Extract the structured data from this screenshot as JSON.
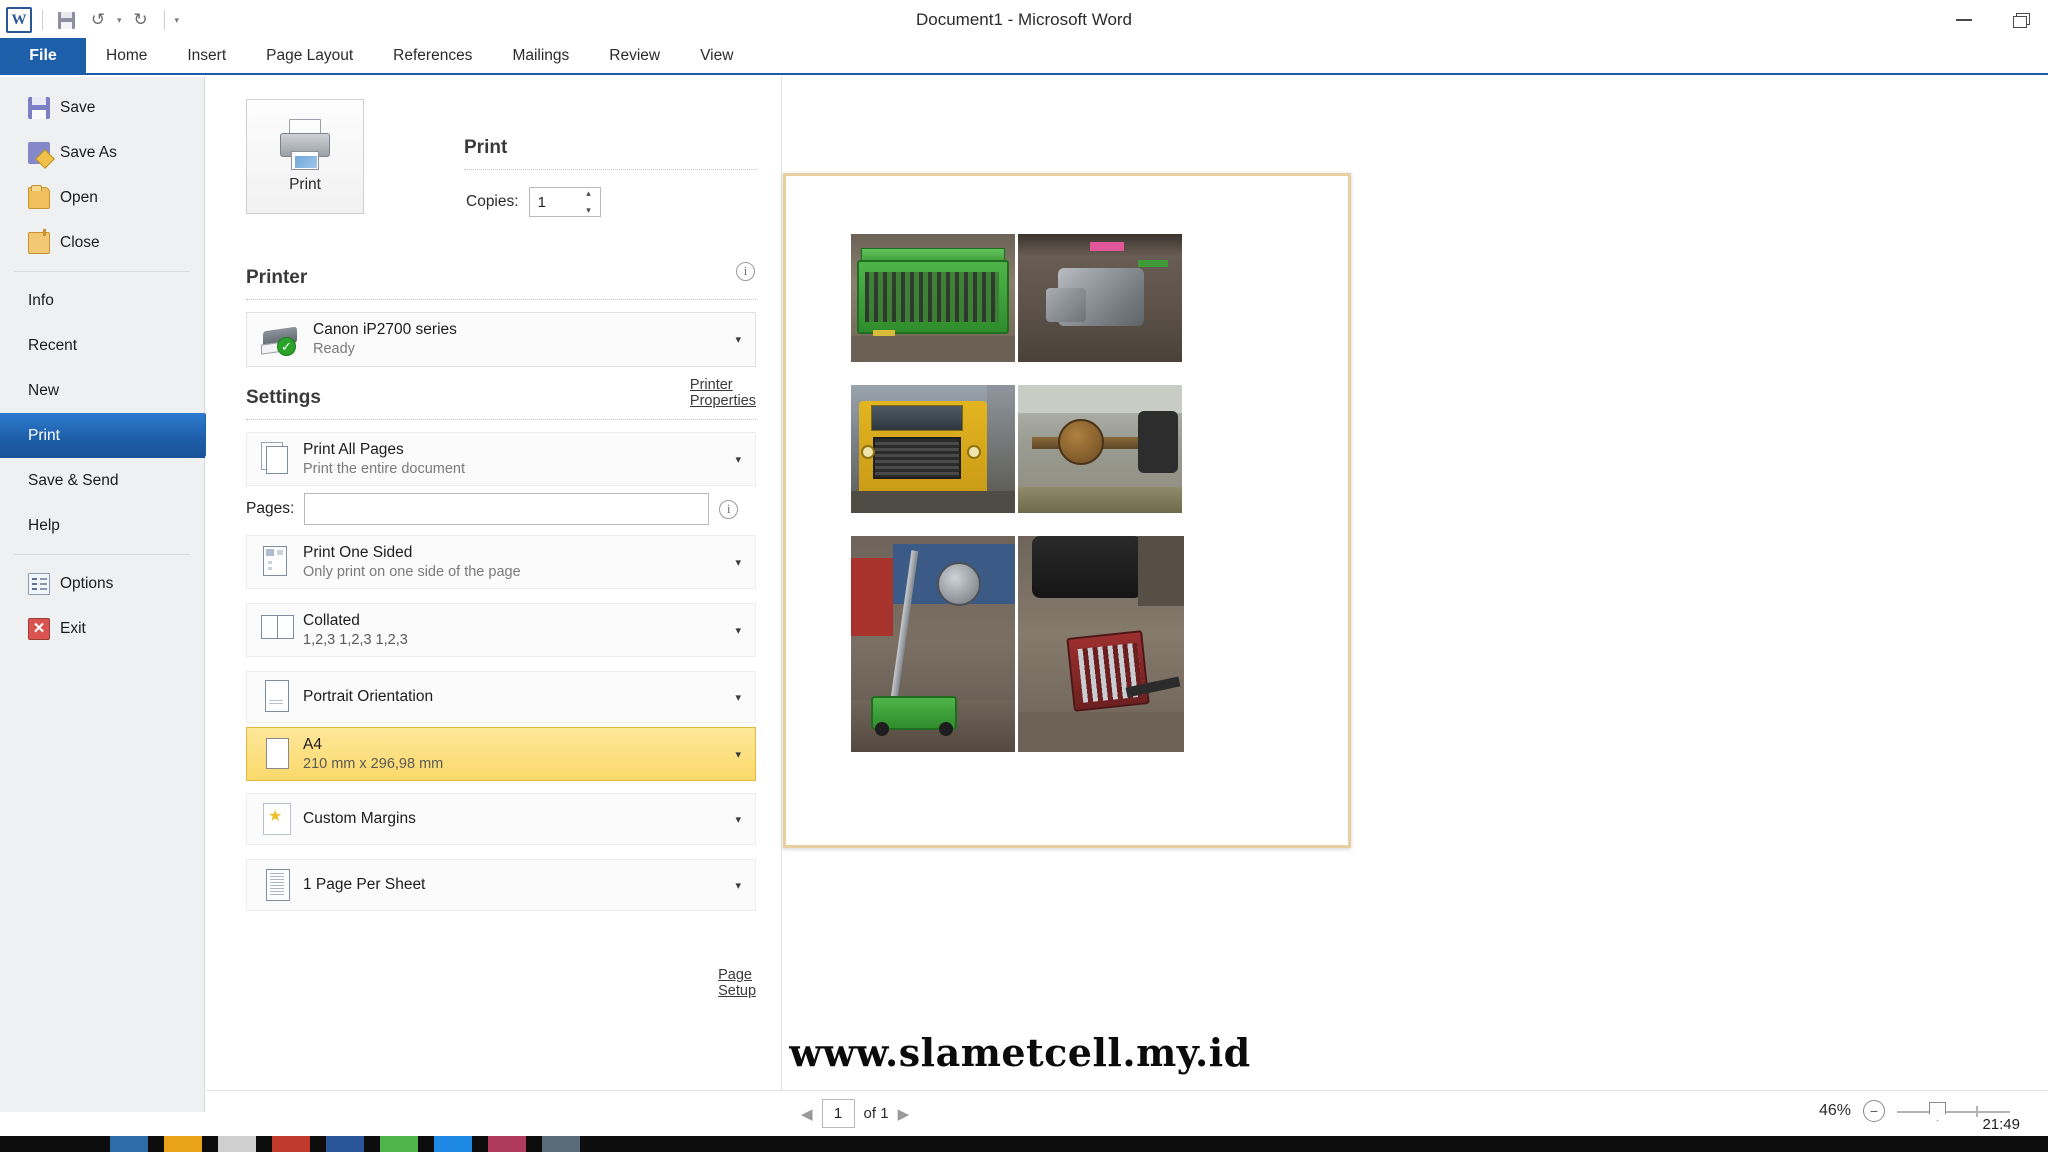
{
  "window": {
    "title": "Document1  -  Microsoft Word",
    "minimize_label": "Minimize",
    "restore_label": "Restore Down",
    "app_icon": "W"
  },
  "quick_access": {
    "save_label": "Save",
    "undo_label": "Undo",
    "undo_caret": "▾",
    "redo_label": "Redo",
    "redo_glyph": "↻",
    "customize_caret": "▾",
    "undo_glyph": "↺"
  },
  "ribbon": {
    "file_tab": "File",
    "tabs": [
      {
        "label": "Home"
      },
      {
        "label": "Insert"
      },
      {
        "label": "Page Layout"
      },
      {
        "label": "References"
      },
      {
        "label": "Mailings"
      },
      {
        "label": "Review"
      },
      {
        "label": "View"
      }
    ]
  },
  "backstage_nav": {
    "commands": [
      {
        "label": "Save",
        "icon": "save-icon"
      },
      {
        "label": "Save As",
        "icon": "save-as-icon"
      },
      {
        "label": "Open",
        "icon": "open-folder-icon"
      },
      {
        "label": "Close",
        "icon": "close-folder-icon"
      }
    ],
    "pages": [
      {
        "label": "Info",
        "active": false
      },
      {
        "label": "Recent",
        "active": false
      },
      {
        "label": "New",
        "active": false
      },
      {
        "label": "Print",
        "active": true
      },
      {
        "label": "Save & Send",
        "active": false
      },
      {
        "label": "Help",
        "active": false
      }
    ],
    "footer": [
      {
        "label": "Options",
        "icon": "options-icon"
      },
      {
        "label": "Exit",
        "icon": "exit-icon"
      }
    ]
  },
  "print": {
    "heading": "Print",
    "print_button_label": "Print",
    "copies_label": "Copies:",
    "copies_value": "1",
    "spin_up": "▴",
    "spin_down": "▾",
    "printer_heading": "Printer",
    "printer_name": "Canon iP2700 series",
    "printer_status": "Ready",
    "printer_check": "✓",
    "printer_properties_link": "Printer Properties",
    "info_icon_glyph": "i",
    "settings_heading": "Settings",
    "page_setup_link": "Page Setup",
    "caret": "▾",
    "pages_field_label": "Pages:",
    "pages_field_value": "",
    "settings": [
      {
        "title": "Print All Pages",
        "subtitle": "Print the entire document",
        "icon": "print-range-icon",
        "highlight": false
      },
      {
        "title": "Print One Sided",
        "subtitle": "Only print on one side of the page",
        "icon": "one-sided-icon",
        "highlight": false
      },
      {
        "title": "Collated",
        "subtitle": "1,2,3   1,2,3   1,2,3",
        "icon": "collated-icon",
        "highlight": false
      },
      {
        "title": "Portrait Orientation",
        "subtitle": "",
        "icon": "orientation-icon",
        "highlight": false
      },
      {
        "title": "A4",
        "subtitle": "210 mm x 296,98 mm",
        "icon": "paper-size-icon",
        "highlight": true
      },
      {
        "title": "Custom Margins",
        "subtitle": "",
        "icon": "margins-icon",
        "highlight": false
      },
      {
        "title": "1 Page Per Sheet",
        "subtitle": "",
        "icon": "pages-per-sheet-icon",
        "highlight": false
      }
    ]
  },
  "preview": {
    "page_images": [
      {
        "name": "green-toolbox-photo"
      },
      {
        "name": "engine-block-photo"
      },
      {
        "name": "yellow-truck-photo"
      },
      {
        "name": "rusty-axle-photo"
      },
      {
        "name": "floor-jack-photo"
      },
      {
        "name": "socket-set-photo"
      }
    ]
  },
  "watermark": {
    "text": "www.slametcell.my.id"
  },
  "statusbar": {
    "prev_glyph": "◀",
    "next_glyph": "▶",
    "current_page": "1",
    "of_text": "of 1",
    "zoom_percent": "46%",
    "zoom_out_glyph": "−",
    "zoom_in_glyph": "+"
  },
  "taskbar": {
    "clock": "21:49"
  },
  "colors": {
    "accent_blue": "#1e5faa",
    "highlight_amber": "#fbd96a",
    "status_green": "#29a329",
    "page_border": "#e8cfa0"
  }
}
